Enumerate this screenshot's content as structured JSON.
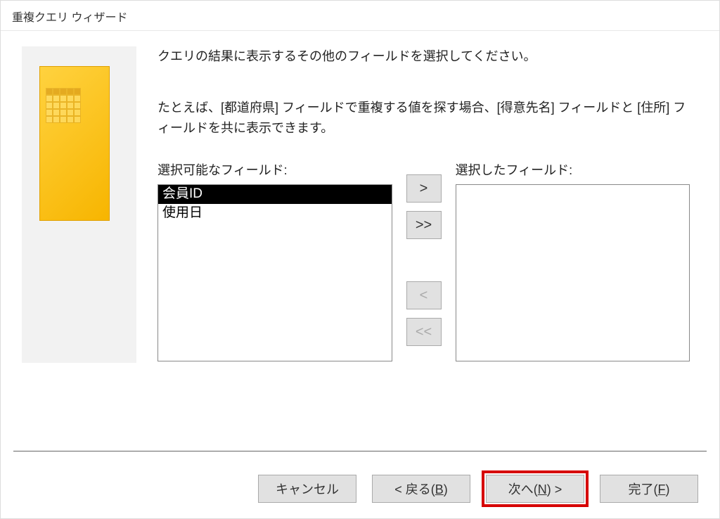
{
  "title": "重複クエリ ウィザード",
  "instruction": "クエリの結果に表示するその他のフィールドを選択してください。",
  "example": "たとえば、[都道府県] フィールドで重複する値を探す場合、[得意先名] フィールドと [住所] フィールドを共に表示できます。",
  "available_label": "選択可能なフィールド:",
  "selected_label": "選択したフィールド:",
  "available_fields": [
    "会員ID",
    "使用日"
  ],
  "selected_fields": [],
  "buttons": {
    "add": ">",
    "add_all": ">>",
    "remove": "<",
    "remove_all": "<<",
    "cancel": "キャンセル",
    "back_text": "< 戻る(",
    "back_mnemonic": "B",
    "back_suffix": ")",
    "next_text": "次へ(",
    "next_mnemonic": "N",
    "next_suffix": ") >",
    "finish_text": "完了(",
    "finish_mnemonic": "F",
    "finish_suffix": ")"
  }
}
